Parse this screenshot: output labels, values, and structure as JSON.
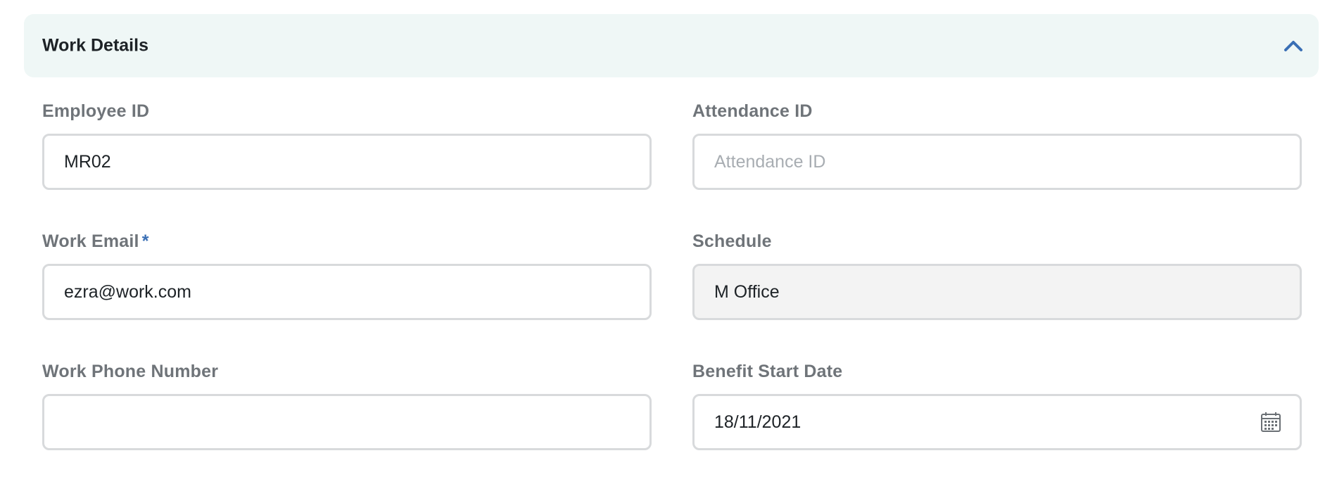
{
  "section": {
    "title": "Work Details",
    "toggle_icon": "chevron-up-icon",
    "accent_color": "#3a6fb5",
    "header_bg": "#eff7f6"
  },
  "fields": {
    "employee_id": {
      "label": "Employee ID",
      "value": "MR02",
      "placeholder": ""
    },
    "attendance_id": {
      "label": "Attendance ID",
      "value": "",
      "placeholder": "Attendance ID"
    },
    "work_email": {
      "label": "Work Email",
      "required_mark": "*",
      "value": "ezra@work.com"
    },
    "schedule": {
      "label": "Schedule",
      "value": "M Office"
    },
    "work_phone": {
      "label": "Work Phone Number",
      "value": ""
    },
    "benefit_start_date": {
      "label": "Benefit Start Date",
      "value": "18/11/2021",
      "icon": "calendar-icon"
    }
  }
}
